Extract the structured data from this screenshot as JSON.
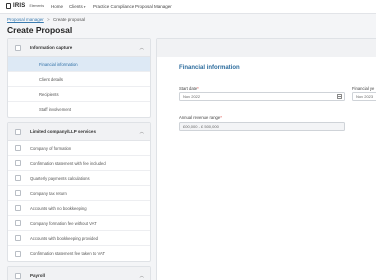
{
  "nav": {
    "logo_text": "IRIS",
    "logo_sub": "Elements",
    "items": [
      {
        "label": "Home"
      },
      {
        "label": "Clients"
      },
      {
        "label": "Practice Compliance"
      },
      {
        "label": "Proposal Manager"
      }
    ]
  },
  "breadcrumb": {
    "link": "Proposal manager",
    "separator": ">",
    "current": "Create proposal"
  },
  "page_title": "Create Proposal",
  "sidebar": {
    "sections": [
      {
        "title": "Information capture",
        "items": [
          {
            "label": "Financial information",
            "active": true
          },
          {
            "label": "Client details"
          },
          {
            "label": "Recipients"
          },
          {
            "label": "Staff involvement"
          }
        ]
      },
      {
        "title": "Limited company/LLP services",
        "items": [
          {
            "label": "Company of formation"
          },
          {
            "label": "Confirmation statement with fee included"
          },
          {
            "label": "Quarterly payments calculations"
          },
          {
            "label": "Company tax return"
          },
          {
            "label": "Accounts with no bookkeeping"
          },
          {
            "label": "Company formation fee without VAT"
          },
          {
            "label": "Accounts with bookkeeping provided"
          },
          {
            "label": "Confirmation statement fee taken to VAT"
          }
        ]
      },
      {
        "title": "Payroll",
        "items": []
      }
    ]
  },
  "main": {
    "title": "Financial information",
    "start_date": {
      "label": "Start date",
      "value": "Nov 2022"
    },
    "financial_year": {
      "label": "Financial ye",
      "value": "Nov 2023"
    },
    "revenue_range": {
      "label": "Annual revenue range",
      "value": "£00,000 - £ 500,000"
    }
  },
  "colors": {
    "accent": "#2e6d9e",
    "active_bg": "#dde9f5",
    "required": "#d9342b"
  }
}
